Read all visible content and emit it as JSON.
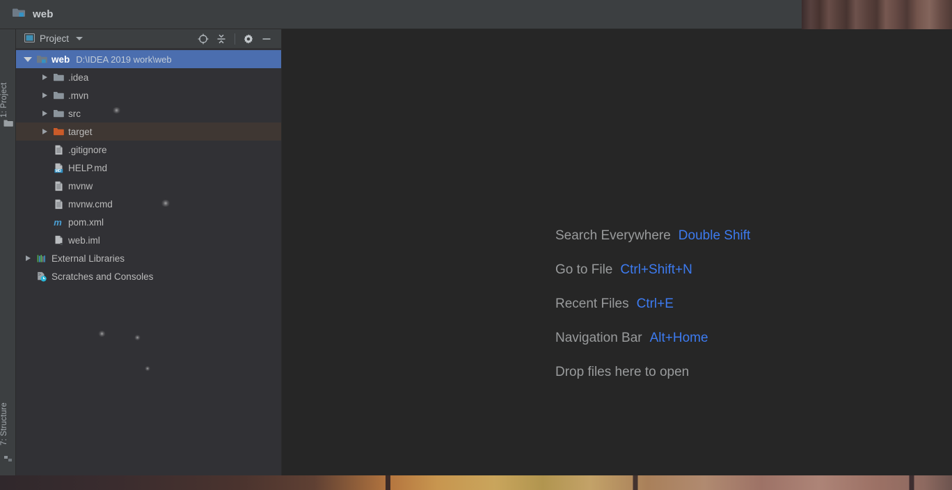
{
  "window": {
    "title": "web",
    "project_icon": "project-folder-icon"
  },
  "toolwindow_bars": {
    "left_top": {
      "label": "1: Project",
      "icon": "folder-icon"
    },
    "left_bottom": {
      "label": "7: Structure",
      "icon": "structure-icon"
    }
  },
  "project_panel": {
    "header": {
      "title": "Project",
      "view_icon": "project-view-icon",
      "dropdown_icon": "chevron-down-icon",
      "actions": [
        {
          "name": "scroll-from-source-icon",
          "tooltip": "Select Opened File"
        },
        {
          "name": "collapse-all-icon",
          "tooltip": "Collapse All"
        },
        {
          "name": "gear-icon",
          "tooltip": "Settings"
        },
        {
          "name": "minimize-icon",
          "tooltip": "Hide"
        }
      ]
    },
    "tree": [
      {
        "name": "web",
        "path": "D:\\IDEA 2019 work\\web",
        "icon": "project-folder-icon",
        "arrow": "expanded",
        "indent": 0,
        "state": "selected"
      },
      {
        "name": ".idea",
        "path": "",
        "icon": "folder-icon",
        "arrow": "collapsed",
        "indent": 1,
        "state": "normal"
      },
      {
        "name": ".mvn",
        "path": "",
        "icon": "folder-icon",
        "arrow": "collapsed",
        "indent": 1,
        "state": "normal"
      },
      {
        "name": "src",
        "path": "",
        "icon": "folder-icon",
        "arrow": "collapsed",
        "indent": 1,
        "state": "normal"
      },
      {
        "name": "target",
        "path": "",
        "icon": "folder-orange-icon",
        "arrow": "collapsed",
        "indent": 1,
        "state": "hovered"
      },
      {
        "name": ".gitignore",
        "path": "",
        "icon": "text-file-icon",
        "arrow": "none",
        "indent": 1,
        "state": "normal"
      },
      {
        "name": "HELP.md",
        "path": "",
        "icon": "markdown-file-icon",
        "arrow": "none",
        "indent": 1,
        "state": "normal"
      },
      {
        "name": "mvnw",
        "path": "",
        "icon": "text-file-icon",
        "arrow": "none",
        "indent": 1,
        "state": "normal"
      },
      {
        "name": "mvnw.cmd",
        "path": "",
        "icon": "text-file-icon",
        "arrow": "none",
        "indent": 1,
        "state": "normal"
      },
      {
        "name": "pom.xml",
        "path": "",
        "icon": "maven-file-icon",
        "arrow": "none",
        "indent": 1,
        "state": "normal"
      },
      {
        "name": "web.iml",
        "path": "",
        "icon": "module-file-icon",
        "arrow": "none",
        "indent": 1,
        "state": "normal"
      },
      {
        "name": "External Libraries",
        "path": "",
        "icon": "libraries-icon",
        "arrow": "collapsed",
        "indent": 0,
        "state": "normal"
      },
      {
        "name": "Scratches and Consoles",
        "path": "",
        "icon": "scratches-icon",
        "arrow": "none",
        "indent": 0,
        "state": "normal"
      }
    ]
  },
  "editor": {
    "hints": [
      {
        "what": "Search Everywhere",
        "key": "Double Shift"
      },
      {
        "what": "Go to File",
        "key": "Ctrl+Shift+N"
      },
      {
        "what": "Recent Files",
        "key": "Ctrl+E"
      },
      {
        "what": "Navigation Bar",
        "key": "Alt+Home"
      },
      {
        "what": "Drop files here to open",
        "key": ""
      }
    ]
  },
  "colors": {
    "selection_blue": "#4b6eaf",
    "hover_brown": "#3f3733",
    "link_blue": "#3d7bf0",
    "panel_bg": "#313135",
    "editor_bg": "#262626",
    "chrome_bg": "#3c3f41",
    "folder_orange": "#cb5b29"
  }
}
